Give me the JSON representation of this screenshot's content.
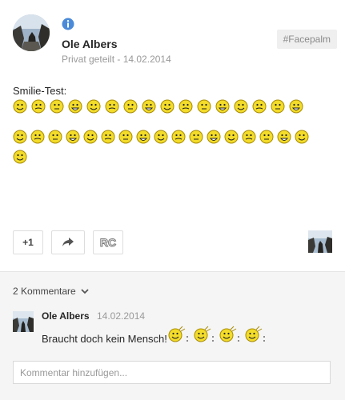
{
  "post": {
    "author": "Ole Albers",
    "visibility": "Privat geteilt",
    "separator": " - ",
    "date": "14.02.2014",
    "tag": "#Facepalm",
    "text": "Smilie-Test:",
    "emoji_rows": [
      [
        "smiley-icon",
        "smirk-icon",
        "grin-icon",
        "hamburger-icon",
        "cat-icon",
        "squint-icon",
        "question-icon",
        "cool-icon",
        "sad-cry-icon",
        "fork-knife-icon",
        "pacifier-icon",
        "flat-face-icon",
        "bomb-icon",
        "help-sign-icon",
        "happy-icon",
        "glass-icon"
      ],
      [
        "stick-icon",
        "sweat-icon",
        "red-face-icon",
        "party-hat-icon",
        "wave-icon",
        "cheer-icon",
        "police-icon",
        "monster-icon",
        "smile-2-icon",
        "frown-icon",
        "neutral-icon",
        "thumbs-up-icon",
        "laughing-icon",
        "thumb-up-icon",
        "wink-icon",
        "tongue-icon",
        "grin-2-icon"
      ],
      [
        "big-smile-icon"
      ]
    ]
  },
  "actions": {
    "plus_label": "+1",
    "share_label": "share",
    "rc_label": "RC"
  },
  "comments": {
    "count_label": "2 Kommentare",
    "items": [
      {
        "author": "Ole Albers",
        "date": "14.02.2014",
        "text": "Braucht doch kein Mensch!",
        "emoji_count": 4
      }
    ],
    "input_placeholder": "Kommentar hinzufügen..."
  },
  "colors": {
    "accent_blue": "#4a8ad8",
    "emoji_yellow": "#f3dc2a",
    "emoji_stroke": "#a88b00"
  }
}
